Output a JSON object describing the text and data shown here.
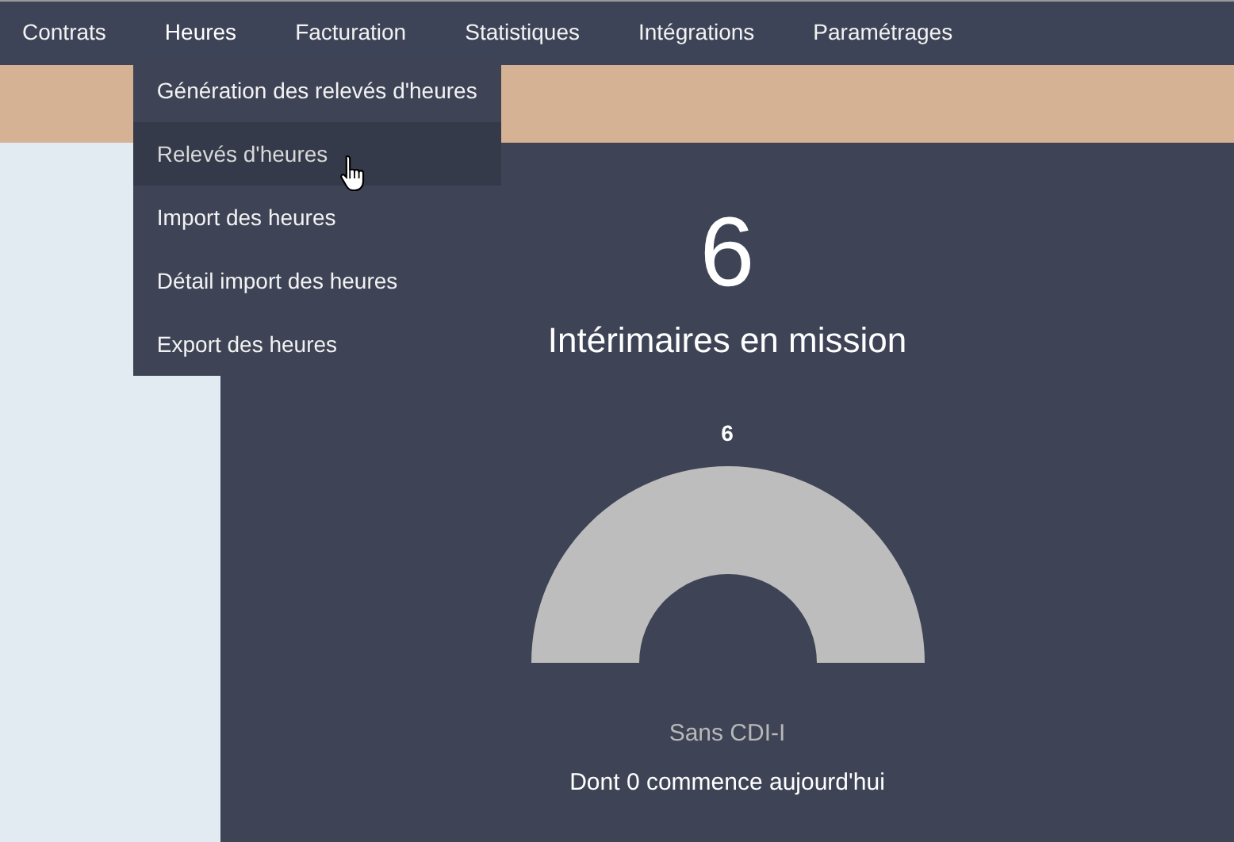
{
  "nav": {
    "items": [
      {
        "label": "Contrats",
        "expanded": false
      },
      {
        "label": "Heures",
        "expanded": true,
        "menu": [
          {
            "label": "Génération des relevés d'heures",
            "selected": false
          },
          {
            "label": "Relevés d'heures",
            "selected": true
          },
          {
            "label": "Import des heures",
            "selected": false
          },
          {
            "label": "Détail import des heures",
            "selected": false
          },
          {
            "label": "Export des heures",
            "selected": false
          }
        ]
      },
      {
        "label": "Facturation",
        "expanded": false
      },
      {
        "label": "Statistiques",
        "expanded": false
      },
      {
        "label": "Intégrations",
        "expanded": false
      },
      {
        "label": "Paramétrages",
        "expanded": false
      }
    ]
  },
  "stat": {
    "value": "6",
    "label": "Intérimaires en mission",
    "gauge_label": "6",
    "caption": "Sans CDI-I",
    "note": "Dont 0 commence aujourd'hui"
  }
}
